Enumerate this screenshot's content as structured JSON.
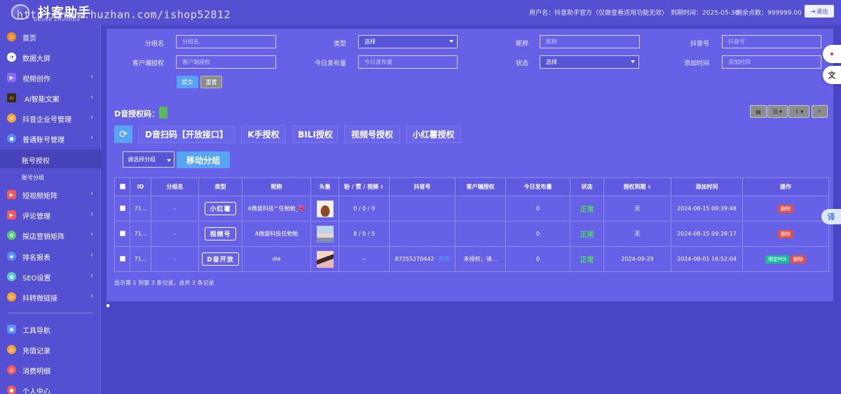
{
  "header": {
    "logo_text": "抖客助手",
    "logo_sub": "DOUKE ZHUSHOU",
    "watermark": "http://www.huzhan.com/ishop52812",
    "user_info": "用户名：抖音助手官方（仅做查看适用功能无效）",
    "expire_info": "到期时间：2025-05-30",
    "points_info": "剩余点数：999999.00",
    "logout_label": "退出"
  },
  "sidebar": {
    "items": [
      {
        "label": "首页",
        "icon": "home-icon",
        "color": "#f28c28",
        "has_children": false
      },
      {
        "label": "数据大屏",
        "icon": "pie-chart-icon",
        "color": "#ffffff",
        "has_children": false
      },
      {
        "label": "视频创作",
        "icon": "video-icon",
        "color": "#8a6cf7",
        "has_children": true
      },
      {
        "label": "AI智能文案",
        "icon": "ai-icon",
        "color": "#f28c28",
        "has_children": true
      },
      {
        "label": "抖音企业号管理",
        "icon": "gear-icon",
        "color": "#f2a33a",
        "has_children": true
      },
      {
        "label": "普通账号管理",
        "icon": "account-icon",
        "color": "#5a8ef5",
        "has_children": true
      }
    ],
    "sub_items": [
      {
        "label": "账号授权",
        "active": true
      },
      {
        "label": "账号分组",
        "active": false
      }
    ],
    "items2": [
      {
        "label": "短视频矩阵",
        "icon": "video-matrix-icon",
        "color": "#f05a5a",
        "has_children": true
      },
      {
        "label": "评论管理",
        "icon": "comment-icon",
        "color": "#f05a5a",
        "has_children": true
      },
      {
        "label": "探店营销矩阵",
        "icon": "shop-icon",
        "color": "#5cc97a",
        "has_children": true
      },
      {
        "label": "排名报表",
        "icon": "shield-icon",
        "color": "#5a8ef5",
        "has_children": true
      },
      {
        "label": "SEO设置",
        "icon": "seo-icon",
        "color": "#5cc9c9",
        "has_children": true
      },
      {
        "label": "抖转微链接",
        "icon": "link-icon",
        "color": "#f2a33a",
        "has_children": true
      }
    ],
    "items3": [
      {
        "label": "工具导航",
        "icon": "tool-icon",
        "color": "#5a8ef5"
      },
      {
        "label": "充值记录",
        "icon": "recharge-icon",
        "color": "#f2a33a"
      },
      {
        "label": "消费明细",
        "icon": "consume-icon",
        "color": "#f05a5a"
      },
      {
        "label": "个人中心",
        "icon": "user-icon",
        "color": "#f05a5a"
      }
    ]
  },
  "filters": {
    "group_label": "分组名",
    "group_placeholder": "分组名",
    "type_label": "类型",
    "type_value": "选择",
    "nickname_label": "昵称",
    "nickname_placeholder": "昵称",
    "douyin_label": "抖音号",
    "douyin_placeholder": "抖音号",
    "client_label": "客户端授权",
    "client_placeholder": "客户端授权",
    "today_label": "今日发布量",
    "today_placeholder": "今日发布量",
    "status_label": "状态",
    "status_value": "选择",
    "addtime_label": "添加时间",
    "addtime_placeholder": "添加时间",
    "submit_label": "提交",
    "reset_label": "重置"
  },
  "auth": {
    "label": "D音授权码："
  },
  "tabs": [
    "D音扫码【开放接口】",
    "K手授权",
    "BILI授权",
    "视频号授权",
    "小红薯授权"
  ],
  "group_move": {
    "select_value": "请选择分组",
    "move_label": "移动分组"
  },
  "table": {
    "headers": [
      "ID",
      "分组名",
      "类型",
      "昵称",
      "头像",
      "粉 / 赞 / 视频",
      "抖音号",
      "客户端授权",
      "今日发布量",
      "状态",
      "授权到期",
      "添加时间",
      "操作"
    ],
    "rows": [
      {
        "id": "71...",
        "group": "-",
        "type": "小红薯",
        "nickname": "A微盛科技^任勉勉_🌺",
        "avatar": "bowl",
        "stats": "0 / 0 / 0",
        "douyin": "",
        "edit": "",
        "client": "",
        "today": "0",
        "status": "正常",
        "expire": "无",
        "added": "2024-08-15 09:39:48",
        "bind": "",
        "delete": "删除"
      },
      {
        "id": "71...",
        "group": "-",
        "type": "视频号",
        "nickname": "A微盛科技任勉勉",
        "avatar": "person1",
        "stats": "8 / 0 / 5",
        "douyin": "",
        "edit": "",
        "client": "",
        "today": "0",
        "status": "正常",
        "expire": "无",
        "added": "2024-08-15 09:39:17",
        "bind": "",
        "delete": "删除"
      },
      {
        "id": "71...",
        "group": "-",
        "type": "D音开放",
        "nickname": "die",
        "avatar": "person2",
        "stats": "--",
        "douyin": "87255270442",
        "edit": "修改",
        "client": "未授权，请...",
        "today": "0",
        "status": "正常",
        "expire": "2024-09-29",
        "added": "2024-08-01 16:52:04",
        "bind": "绑定POI",
        "delete": "删除"
      }
    ],
    "footer": "显示第 1 到第 3 条记录，总共 3 条记录"
  },
  "float": {
    "trans_label": "译"
  }
}
